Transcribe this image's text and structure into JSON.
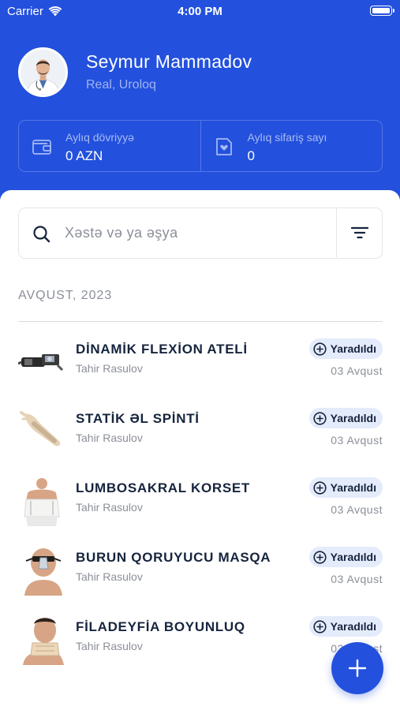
{
  "status_bar": {
    "carrier": "Carrier",
    "time": "4:00 PM"
  },
  "profile": {
    "name": "Seymur Mammadov",
    "role": "Real, Uroloq"
  },
  "stats": [
    {
      "label": "Aylıq dövriyyə",
      "value": "0 AZN",
      "icon": "wallet-icon"
    },
    {
      "label": "Aylıq sifariş sayı",
      "value": "0",
      "icon": "heart-document-icon"
    }
  ],
  "search": {
    "placeholder": "Xəstə və ya əşya"
  },
  "section": {
    "title": "AVQUST,  2023"
  },
  "items": [
    {
      "title": "DİNAMİK FLEXİON ATELİ",
      "patient": "Tahir Rasulov",
      "status": "Yaradıldı",
      "date": "03 Avqust"
    },
    {
      "title": "STATİK ƏL SPİNTİ",
      "patient": "Tahir Rasulov",
      "status": "Yaradıldı",
      "date": "03 Avqust"
    },
    {
      "title": "LUMBOSAKRAL KORSET",
      "patient": "Tahir Rasulov",
      "status": "Yaradıldı",
      "date": "03 Avqust"
    },
    {
      "title": "BURUN QORUYUCU MASQA",
      "patient": "Tahir Rasulov",
      "status": "Yaradıldı",
      "date": "03 Avqust"
    },
    {
      "title": "FİLADEYFİA BOYUNLUQ",
      "patient": "Tahir Rasulov",
      "status": "Yaradıldı",
      "date": "03 Avqust"
    }
  ],
  "colors": {
    "primary": "#2350dd",
    "badge_bg": "#e4ebfb",
    "text_dark": "#16243e",
    "text_muted": "#8b8f98"
  }
}
